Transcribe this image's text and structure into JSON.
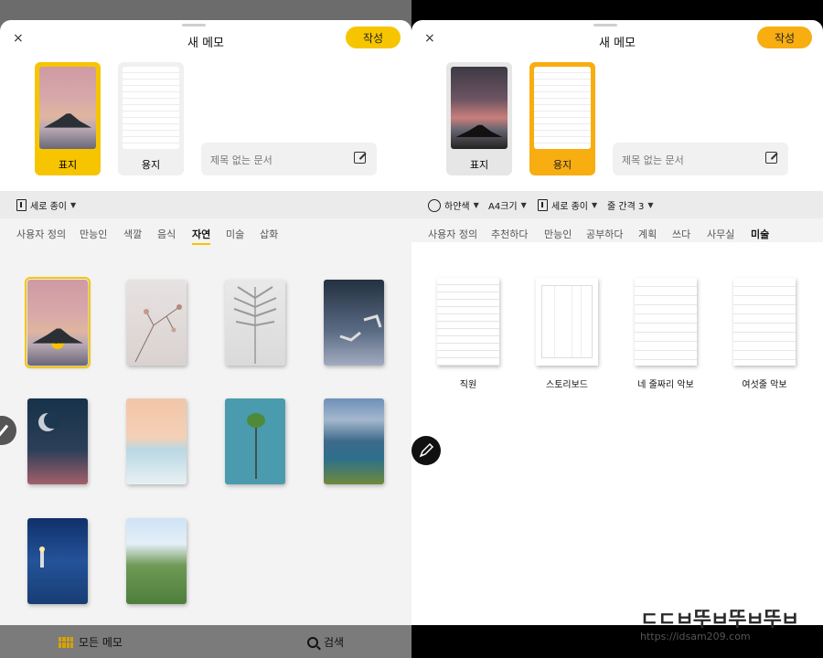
{
  "left": {
    "header": {
      "title": "새 메모",
      "create_label": "작성",
      "close": "×"
    },
    "picks": {
      "cover_label": "표지",
      "paper_label": "용지"
    },
    "title_field": {
      "placeholder": "제목 없는 문서"
    },
    "options": {
      "orientation": "세로 종이"
    },
    "tabs": [
      "사용자 정의",
      "만능인",
      "색깔",
      "음식",
      "자연",
      "미술",
      "삽화"
    ],
    "active_tab": "자연",
    "bottom": {
      "all_memos": "모든 메모",
      "search": "검색"
    }
  },
  "right": {
    "header": {
      "title": "새 메모",
      "create_label": "작성",
      "close": "×"
    },
    "picks": {
      "cover_label": "표지",
      "paper_label": "용지"
    },
    "title_field": {
      "placeholder": "제목 없는 문서"
    },
    "options": {
      "color": "하얀색",
      "size": "A4크기",
      "orientation": "세로 종이",
      "spacing": "줄 간격 3"
    },
    "tabs": [
      "사용자 정의",
      "추천하다",
      "만능인",
      "공부하다",
      "계획",
      "쓰다",
      "사무실",
      "미술"
    ],
    "active_tab": "미술",
    "papers": [
      "직원",
      "스토리보드",
      "네 줄짜리 악보",
      "여섯줄 악보"
    ]
  },
  "watermark": {
    "line1": "ㄷㄷㅂ뚜ㅂ뚜ㅂ뚜ㅂ",
    "line2": "https://idsam209.com"
  },
  "colors": {
    "accent_yellow": "#f6c500",
    "accent_orange": "#f8ad10",
    "overlay_gray": "#6f6f6f"
  }
}
